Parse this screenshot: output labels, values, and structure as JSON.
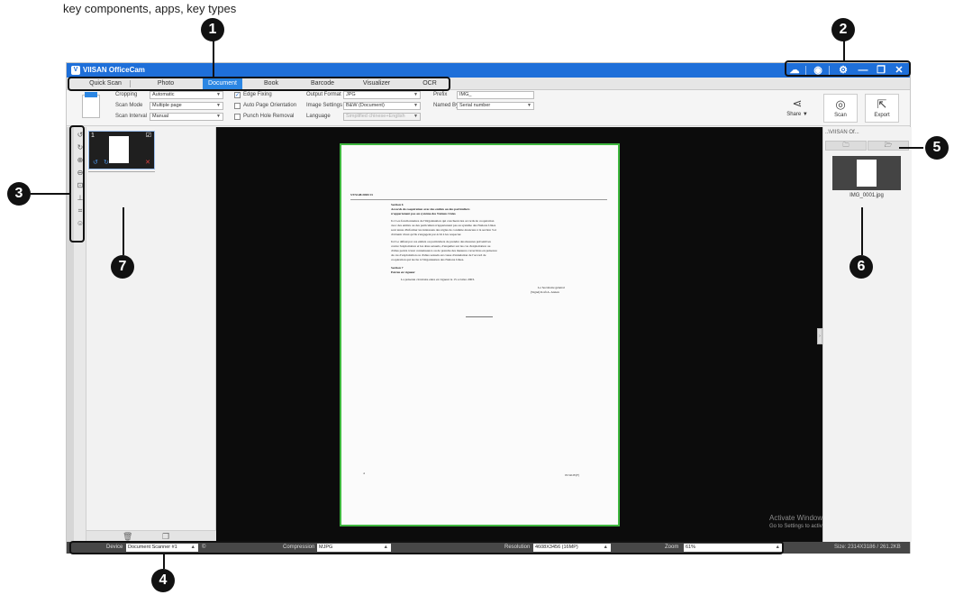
{
  "caption": "key components, apps, key types",
  "window": {
    "title": "VIISAN OfficeCam",
    "controls": [
      "cloud-icon",
      "color-icon",
      "gear-icon",
      "minimize-icon",
      "restore-icon",
      "close-icon"
    ]
  },
  "tabs": [
    "Quick Scan",
    "Photo",
    "Document",
    "Book",
    "Barcode",
    "Visualizer",
    "OCR"
  ],
  "active_tab": "Document",
  "toolbar": {
    "cropping_label": "Cropping",
    "cropping_value": "Automatic",
    "scan_mode_label": "Scan Mode",
    "scan_mode_value": "Multiple page",
    "scan_interval_label": "Scan Interval",
    "scan_interval_value": "Manual",
    "edge_fixing": "Edge Fixing",
    "auto_page_orientation": "Auto Page Orientation",
    "punch_hole_removal": "Punch Hole Removal",
    "output_format_label": "Output Format",
    "output_format_value": "JPG",
    "image_settings_label": "Image Settings",
    "image_settings_value": "B&W (Document)",
    "language_label": "Language",
    "language_value": "Simplified chinese+English",
    "prefix_label": "Prefix",
    "prefix_value": "IMG_",
    "named_by_label": "Named By",
    "named_by_value": "Serial number",
    "share_label": "Share ▼",
    "scan_label": "Scan",
    "export_label": "Export"
  },
  "thumbnail": {
    "index": "1"
  },
  "document": {
    "header": "ST/SGB/2003/13",
    "section6_title": "Section 6",
    "section6_sub1": "Accords de coopération avec des entités ou des particuliers",
    "section6_sub2": "n'appartenant pas au système des Nations Unies",
    "p61": [
      "6.1   Les fonctionnaires de l'Organisation qui concluent des accords de coopération",
      "avec des entités ou des particuliers n'appartenant pas au système des Nations Unies",
      "sont tenus d'informer les intéressés des règles de conduite énoncées à la section 3 et",
      "d'obtenir d'eux qu'ils s'engagent par écrit à les respecter."
    ],
    "p62": [
      "6.2   Le défaut par ces entités ou particuliers de prendre des mesures préventives",
      "contre l'exploitation et les abus sexuels, d'enquêter sur les cas d'exploitation ou",
      "d'abus portés à leur connaissance ou de prendre des mesures correctives en présence",
      "de cas d'exploitation ou d'abus sexuels est cause d'annulation de l'accord de",
      "coopération qui les lie à l'Organisation des Nations Unies."
    ],
    "section7_title": "Section 7",
    "section7_sub": "Entrée en vigueur",
    "p7": "La présente circulaire entre en vigueur le 15 octobre 2003.",
    "sig1": "Le Secrétaire général",
    "sig2": "(Signé) Kofi A. Annan",
    "footer_num": "4",
    "footer_code": "03-54128 (F)"
  },
  "watermark": {
    "line1": "Activate Windows",
    "line2": "Go to Settings to activate Windows."
  },
  "output": {
    "path": "..\\VIISAN Of...",
    "file": "IMG_0001.jpg"
  },
  "status": {
    "device_label": "Device",
    "device_value": "Document Scanner #1",
    "compression_label": "Compression",
    "compression_value": "MJPG",
    "resolution_label": "Resolution",
    "resolution_value": "4608X3456 (16MP)",
    "zoom_label": "Zoom",
    "zoom_value": "61%",
    "size_text": "Size: 2314X3186 / 261.2KB"
  },
  "callouts": [
    "1",
    "2",
    "3",
    "4",
    "5",
    "6",
    "7"
  ]
}
